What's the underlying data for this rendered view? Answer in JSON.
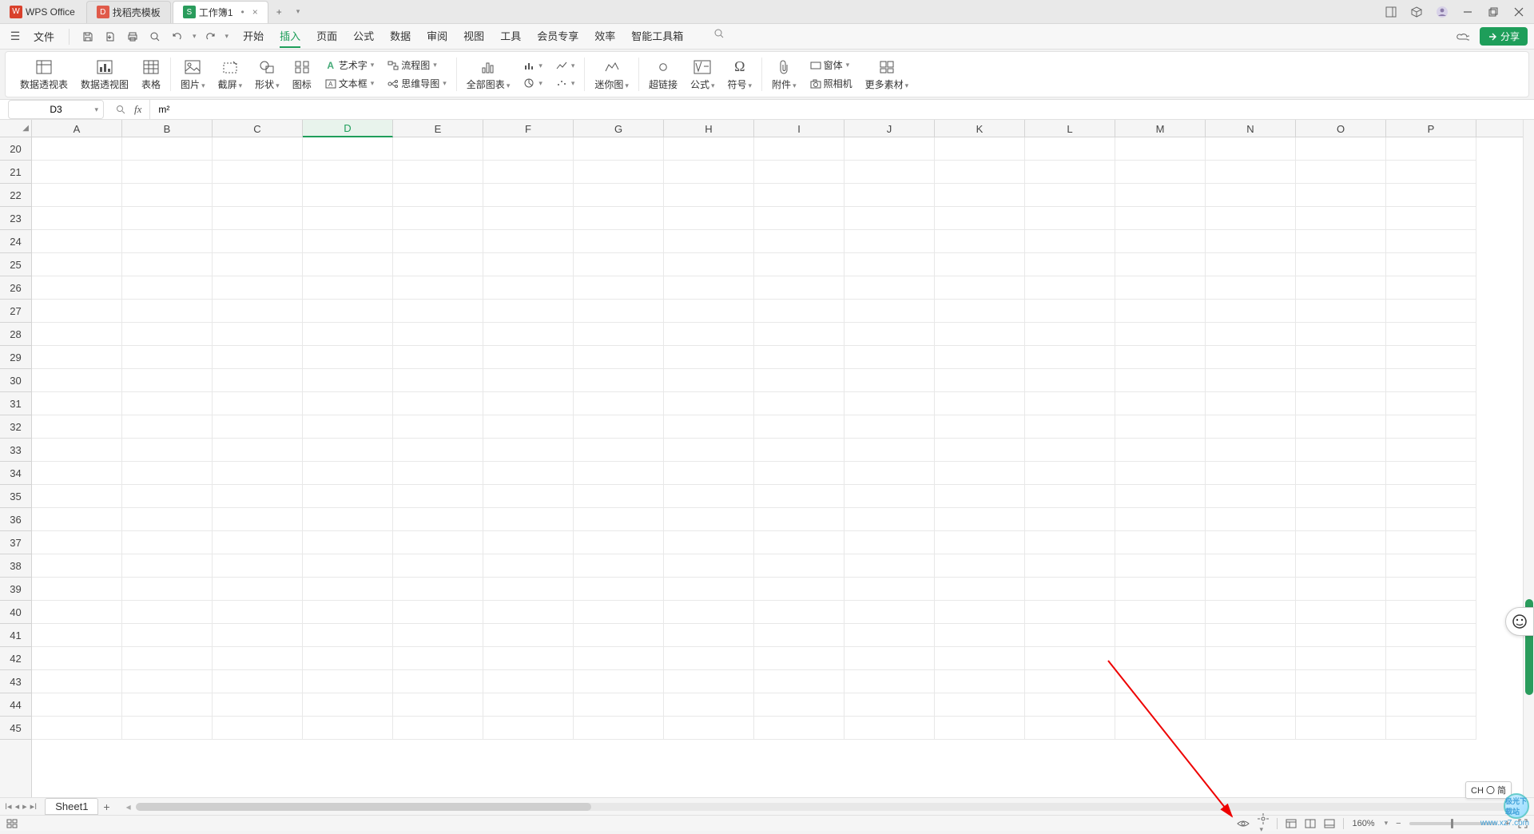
{
  "titlebar": {
    "office_label": "WPS Office",
    "template_label": "找稻壳模板",
    "workbook_label": "工作簿1",
    "tab_close": "×",
    "add_tab": "+"
  },
  "menubar": {
    "file_label": "文件",
    "tabs": [
      "开始",
      "插入",
      "页面",
      "公式",
      "数据",
      "审阅",
      "视图",
      "工具",
      "会员专享",
      "效率",
      "智能工具箱"
    ],
    "share_label": "分享"
  },
  "ribbon": {
    "pivot_table": "数据透视表",
    "pivot_chart": "数据透视图",
    "table": "表格",
    "picture": "图片",
    "screenshot": "截屏",
    "shapes": "形状",
    "icons": "图标",
    "wordart": "艺术字",
    "textbox": "文本框",
    "flowchart": "流程图",
    "mindmap": "思维导图",
    "all_charts": "全部图表",
    "sparkline": "迷你图",
    "hyperlink": "超链接",
    "formula": "公式",
    "symbol": "符号",
    "attachment": "附件",
    "camera": "照相机",
    "more_assets": "更多素材"
  },
  "formula_bar": {
    "cell_ref": "D3",
    "fx": "fx",
    "value": "m²"
  },
  "grid": {
    "columns": [
      "A",
      "B",
      "C",
      "D",
      "E",
      "F",
      "G",
      "H",
      "I",
      "J",
      "K",
      "L",
      "M",
      "N",
      "O",
      "P"
    ],
    "row_start": 20,
    "row_end": 45,
    "selected_col": "D"
  },
  "sheetbar": {
    "sheet_name": "Sheet1",
    "add": "+"
  },
  "ime": {
    "label": "CH 〇 简"
  },
  "statusbar": {
    "zoom": "160%"
  },
  "watermark": {
    "name": "极光下载站",
    "url": "www.xz7.com"
  }
}
